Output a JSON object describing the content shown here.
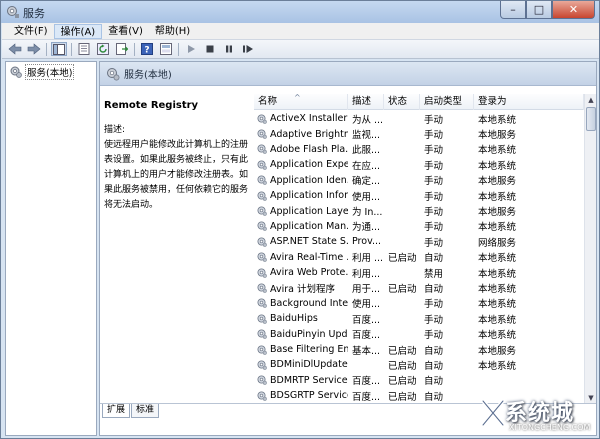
{
  "window": {
    "title": "服务"
  },
  "menubar": {
    "items": [
      "文件(F)",
      "操作(A)",
      "查看(V)",
      "帮助(H)"
    ],
    "active_index": 1
  },
  "toolbar": {
    "icons": [
      "back-arrow-icon",
      "forward-arrow-icon",
      "console-tree-icon",
      "properties-icon",
      "refresh-icon",
      "export-list-icon",
      "help-icon",
      "console-icon",
      "start-service-icon",
      "stop-service-icon",
      "pause-service-icon",
      "restart-service-icon"
    ]
  },
  "tree": {
    "root_label": "服务(本地)"
  },
  "right_pane": {
    "header": "服务(本地)",
    "description": {
      "service_name": "Remote Registry",
      "label": "描述:",
      "lines": [
        "使远程用户能修改此计算机上的注册",
        "表设置。如果此服务被终止，只有此",
        "计算机上的用户才能修改注册表。如",
        "果此服务被禁用，任何依赖它的服务",
        "将无法启动。"
      ]
    }
  },
  "table": {
    "columns": [
      "名称",
      "描述",
      "状态",
      "启动类型",
      "登录为"
    ],
    "sort_indicator": "^",
    "rows": [
      {
        "name": "ActiveX Installer ...",
        "desc": "为从 ...",
        "status": "",
        "startup": "手动",
        "logon": "本地系统"
      },
      {
        "name": "Adaptive Brightn...",
        "desc": "监视...",
        "status": "",
        "startup": "手动",
        "logon": "本地服务"
      },
      {
        "name": "Adobe Flash Pla...",
        "desc": "此服...",
        "status": "",
        "startup": "手动",
        "logon": "本地系统"
      },
      {
        "name": "Application Expe...",
        "desc": "在应...",
        "status": "",
        "startup": "手动",
        "logon": "本地系统"
      },
      {
        "name": "Application Iden...",
        "desc": "确定...",
        "status": "",
        "startup": "手动",
        "logon": "本地服务"
      },
      {
        "name": "Application Infor...",
        "desc": "使用...",
        "status": "",
        "startup": "手动",
        "logon": "本地系统"
      },
      {
        "name": "Application Laye...",
        "desc": "为 In...",
        "status": "",
        "startup": "手动",
        "logon": "本地服务"
      },
      {
        "name": "Application Man...",
        "desc": "为通...",
        "status": "",
        "startup": "手动",
        "logon": "本地系统"
      },
      {
        "name": "ASP.NET State S...",
        "desc": "Prov...",
        "status": "",
        "startup": "手动",
        "logon": "网络服务"
      },
      {
        "name": "Avira Real-Time ...",
        "desc": "利用 ...",
        "status": "已启动",
        "startup": "自动",
        "logon": "本地系统"
      },
      {
        "name": "Avira Web Prote...",
        "desc": " 利用...",
        "status": "",
        "startup": "禁用",
        "logon": "本地系统"
      },
      {
        "name": "Avira 计划程序",
        "desc": "用于...",
        "status": "已启动",
        "startup": "自动",
        "logon": "本地系统"
      },
      {
        "name": "Background Inte...",
        "desc": "使用...",
        "status": "",
        "startup": "手动",
        "logon": "本地系统"
      },
      {
        "name": "BaiduHips",
        "desc": "百度...",
        "status": "",
        "startup": "手动",
        "logon": "本地系统"
      },
      {
        "name": "BaiduPinyin Upd...",
        "desc": "百度...",
        "status": "",
        "startup": "手动",
        "logon": "本地系统"
      },
      {
        "name": "Base Filtering En...",
        "desc": "基本...",
        "status": "已启动",
        "startup": "自动",
        "logon": "本地服务"
      },
      {
        "name": "BDMiniDlUpdate",
        "desc": "",
        "status": "已启动",
        "startup": "自动",
        "logon": "本地系统"
      },
      {
        "name": "BDMRTP Service",
        "desc": "百度...",
        "status": "已启动",
        "startup": "自动",
        "logon": ""
      },
      {
        "name": "BDSGRTP Service",
        "desc": "百度...",
        "status": "已启动",
        "startup": "自动",
        "logon": ""
      }
    ]
  },
  "bottom_tabs": [
    "扩展",
    "标准"
  ],
  "watermark": {
    "text": "系统城",
    "sub": "XITONGCHENG.COM"
  },
  "colors": {
    "title_bar": "#a9c3e4",
    "window_frame": "#d7e4f2",
    "close_button": "#c8452f",
    "header_band": "#c3d2e6"
  }
}
